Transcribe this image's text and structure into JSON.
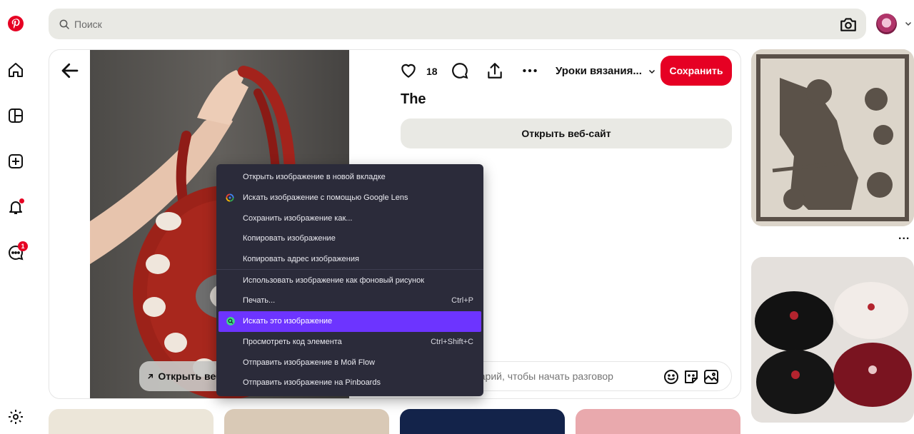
{
  "search": {
    "placeholder": "Поиск"
  },
  "pin": {
    "likes": "18",
    "board_name": "Уроки вязания...",
    "save_label": "Сохранить",
    "title": "The",
    "open_site_label": "Открыть веб-сайт",
    "overlay_open_site_label": "Открыть веб-сайт",
    "comment_placeholder": "ентарий, чтобы начать разговор"
  },
  "context_menu": {
    "items": [
      {
        "label": "Открыть изображение в новой вкладке",
        "shortcut": ""
      },
      {
        "label": "Искать изображение с помощью Google Lens",
        "shortcut": "",
        "icon": "google-lens-icon"
      },
      {
        "label": "Сохранить изображение как...",
        "shortcut": ""
      },
      {
        "label": "Копировать изображение",
        "shortcut": ""
      },
      {
        "label": "Копировать адрес изображения",
        "shortcut": ""
      },
      {
        "label": "Использовать изображение как фоновый рисунок",
        "shortcut": ""
      },
      {
        "label": "Печать...",
        "shortcut": "Ctrl+P"
      },
      {
        "label": "Искать это изображение",
        "shortcut": "",
        "icon": "search-image-icon",
        "selected": true
      },
      {
        "label": "Просмотреть код элемента",
        "shortcut": "Ctrl+Shift+C"
      },
      {
        "label": "Отправить изображение в Мой Flow",
        "shortcut": ""
      },
      {
        "label": "Отправить изображение на Pinboards",
        "shortcut": ""
      }
    ]
  },
  "rail": {
    "notifications_dot": true,
    "messages_badge": "1"
  },
  "colors": {
    "brand": "#e60023",
    "menu_bg": "#2b2b3a",
    "menu_selected": "#6d34ff",
    "pill_bg": "#e9e9e4"
  },
  "right_column": {
    "more_label": "..."
  }
}
